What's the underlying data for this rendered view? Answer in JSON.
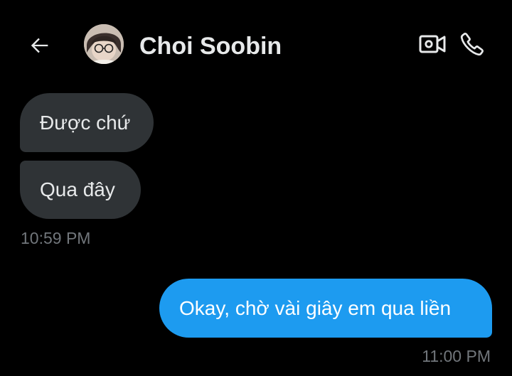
{
  "header": {
    "back_icon": "arrow-left-icon",
    "contact_name": "Choi Soobin",
    "avatar_icon": "profile-photo",
    "video_icon": "video-camera-icon",
    "call_icon": "phone-icon"
  },
  "messages": {
    "received": [
      {
        "text": "Được chứ"
      },
      {
        "text": "Qua đây"
      }
    ],
    "received_time": "10:59 PM",
    "sent": [
      {
        "text": "Okay, chờ vài giây em qua liền"
      }
    ],
    "sent_time": "11:00 PM"
  },
  "colors": {
    "background": "#000000",
    "received_bubble": "#2f3336",
    "sent_bubble": "#1d9bf0",
    "timestamp": "#71767b",
    "text": "#e7e9ea"
  }
}
